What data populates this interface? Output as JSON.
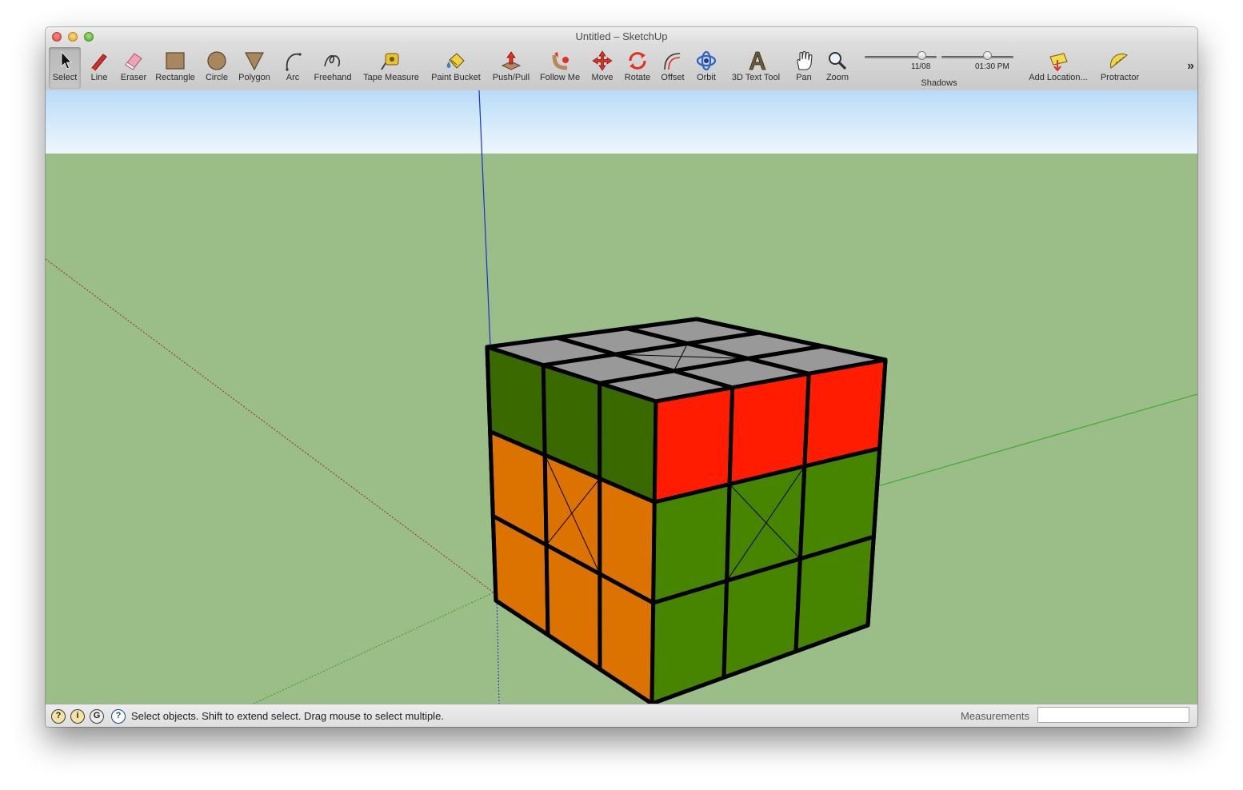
{
  "window": {
    "title": "Untitled – SketchUp"
  },
  "toolbar": {
    "tools": [
      {
        "id": "select",
        "label": "Select"
      },
      {
        "id": "line",
        "label": "Line"
      },
      {
        "id": "eraser",
        "label": "Eraser"
      },
      {
        "id": "rectangle",
        "label": "Rectangle"
      },
      {
        "id": "circle",
        "label": "Circle"
      },
      {
        "id": "polygon",
        "label": "Polygon"
      },
      {
        "id": "arc",
        "label": "Arc"
      },
      {
        "id": "freehand",
        "label": "Freehand"
      },
      {
        "id": "tape",
        "label": "Tape Measure"
      },
      {
        "id": "paint",
        "label": "Paint Bucket"
      },
      {
        "id": "pushpull",
        "label": "Push/Pull"
      },
      {
        "id": "followme",
        "label": "Follow Me"
      },
      {
        "id": "move",
        "label": "Move"
      },
      {
        "id": "rotate",
        "label": "Rotate"
      },
      {
        "id": "offset",
        "label": "Offset"
      },
      {
        "id": "orbit",
        "label": "Orbit"
      },
      {
        "id": "text3d",
        "label": "3D Text Tool"
      },
      {
        "id": "pan",
        "label": "Pan"
      },
      {
        "id": "zoom",
        "label": "Zoom"
      },
      {
        "id": "addlocation",
        "label": "Add Location..."
      },
      {
        "id": "protractor",
        "label": "Protractor"
      }
    ],
    "active_tool": "select",
    "shadows": {
      "label": "Shadows",
      "date": "11/08",
      "time": "01:30 PM",
      "date_position": 0.79,
      "time_position": 0.63
    },
    "overflow_glyph": "»"
  },
  "status": {
    "icons": [
      "location-icon",
      "credits-icon",
      "google-signin-icon",
      "help-icon"
    ],
    "text": "Select objects. Shift to extend select. Drag mouse to select multiple.",
    "measurements_label": "Measurements",
    "measurements_value": ""
  },
  "colors": {
    "sky_top": "#b8dcf7",
    "sky_bottom": "#eef6fd",
    "ground": "#9bbd88",
    "top_face": "#999999",
    "red": "#ff1c00",
    "orange": "#dc7300",
    "dark_green": "#3a6900",
    "green": "#478400"
  }
}
